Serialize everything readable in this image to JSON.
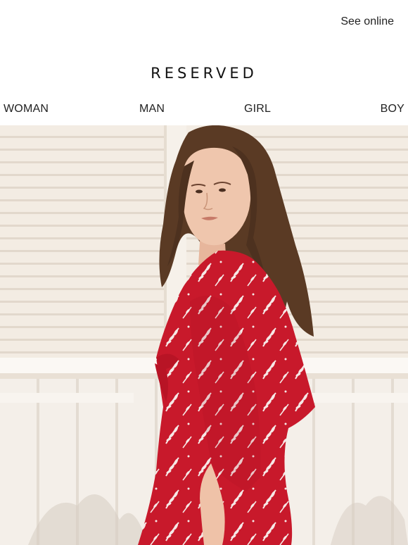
{
  "header": {
    "see_online_label": "See online"
  },
  "brand": {
    "logo_text": "RESERVED"
  },
  "nav": {
    "items": [
      "WOMAN",
      "MAN",
      "GIRL",
      "BOY"
    ]
  },
  "hero": {
    "image": "model in red floral dress against white wall"
  },
  "colors": {
    "dress_red": "#c8192b",
    "wall": "#f1ebe3",
    "hair": "#5a3a24"
  }
}
